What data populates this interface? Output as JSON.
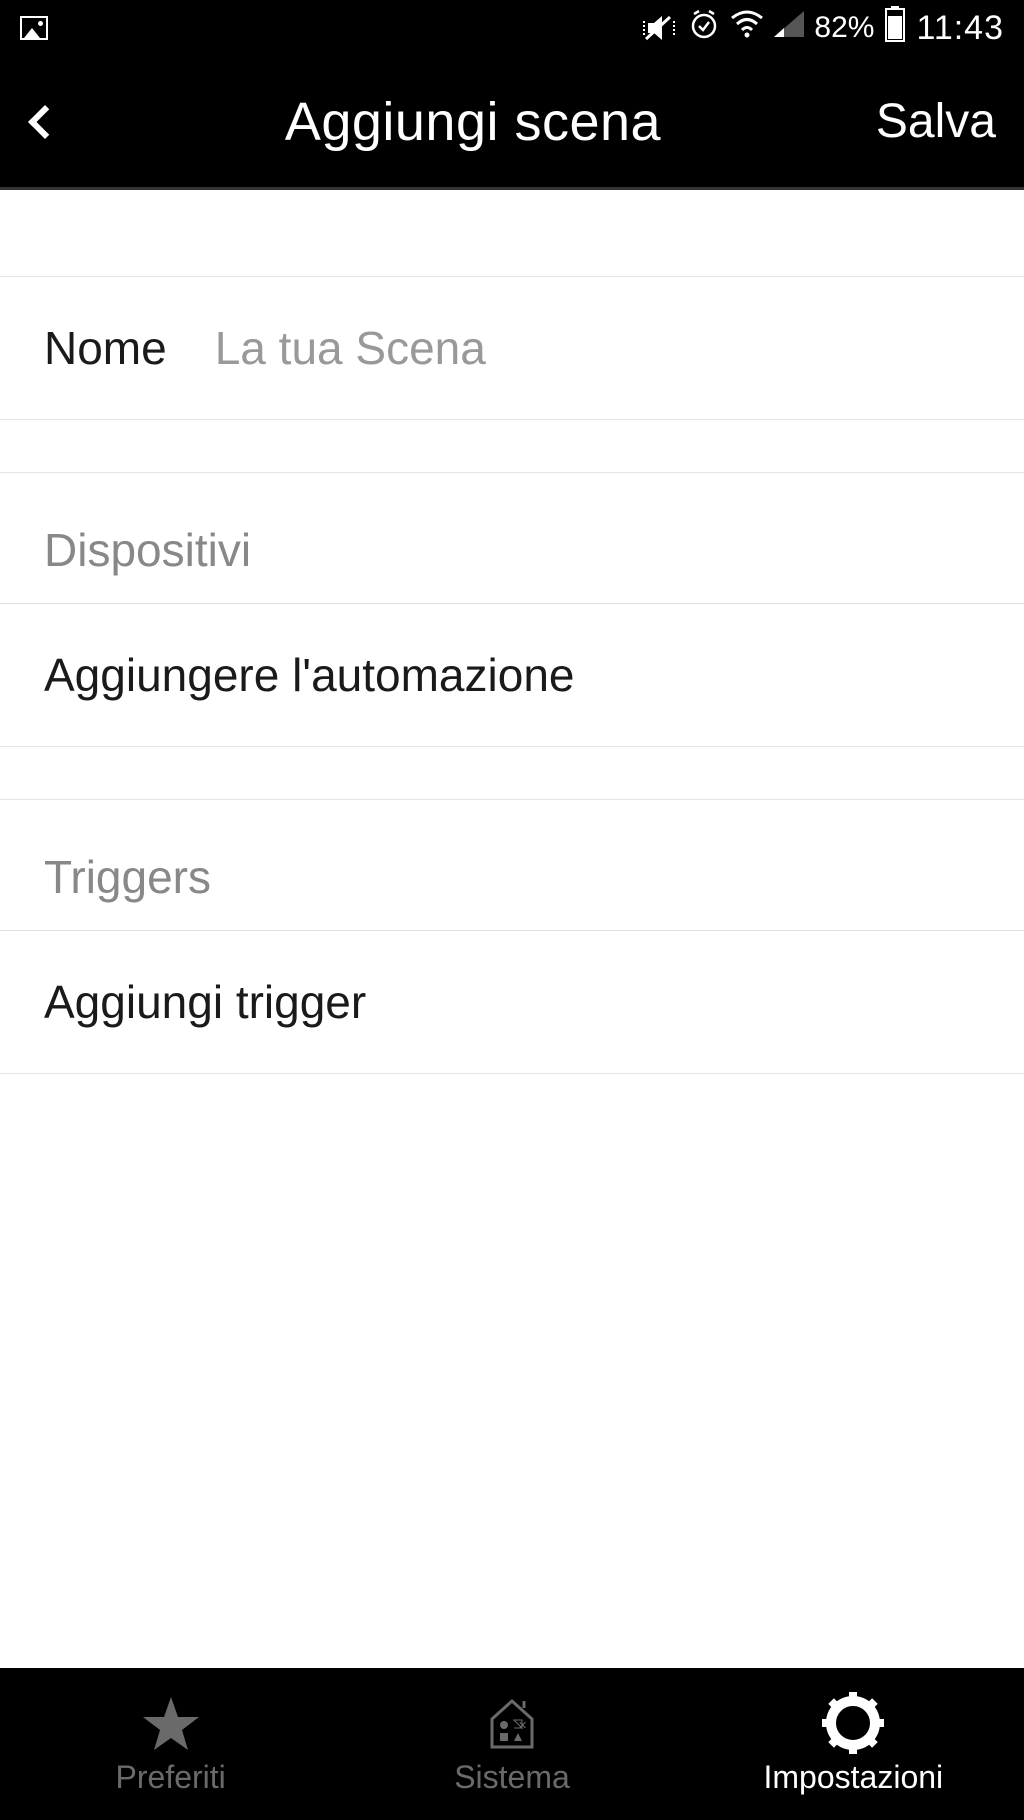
{
  "status_bar": {
    "battery_pct": "82%",
    "time": "11:43"
  },
  "header": {
    "title": "Aggiungi scena",
    "save_label": "Salva"
  },
  "name_section": {
    "label": "Nome",
    "placeholder": "La tua Scena",
    "value": ""
  },
  "devices_section": {
    "header": "Dispositivi",
    "add_label": "Aggiungere l'automazione"
  },
  "triggers_section": {
    "header": "Triggers",
    "add_label": "Aggiungi trigger"
  },
  "bottom_nav": {
    "items": [
      {
        "label": "Preferiti",
        "active": false
      },
      {
        "label": "Sistema",
        "active": false
      },
      {
        "label": "Impostazioni",
        "active": true
      }
    ]
  }
}
